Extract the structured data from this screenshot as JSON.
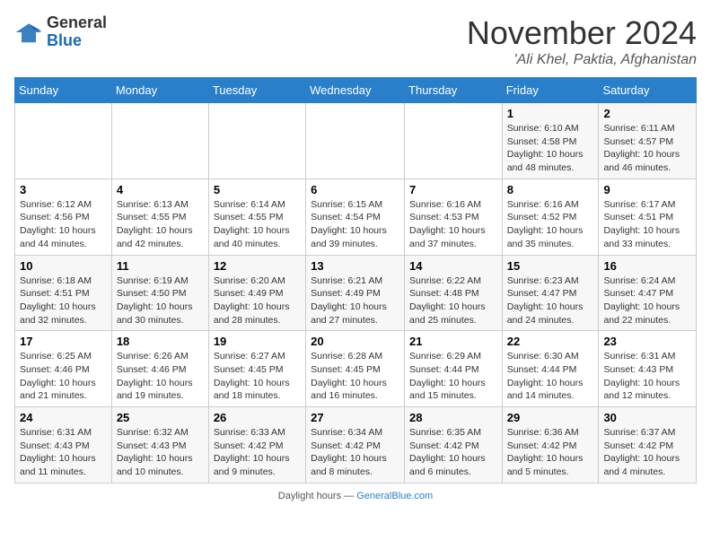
{
  "header": {
    "logo": {
      "general": "General",
      "blue": "Blue"
    },
    "title": "November 2024",
    "location": "'Ali Khel, Paktia, Afghanistan"
  },
  "days_of_week": [
    "Sunday",
    "Monday",
    "Tuesday",
    "Wednesday",
    "Thursday",
    "Friday",
    "Saturday"
  ],
  "weeks": [
    [
      {
        "day": "",
        "info": ""
      },
      {
        "day": "",
        "info": ""
      },
      {
        "day": "",
        "info": ""
      },
      {
        "day": "",
        "info": ""
      },
      {
        "day": "",
        "info": ""
      },
      {
        "day": "1",
        "info": "Sunrise: 6:10 AM\nSunset: 4:58 PM\nDaylight: 10 hours and 48 minutes."
      },
      {
        "day": "2",
        "info": "Sunrise: 6:11 AM\nSunset: 4:57 PM\nDaylight: 10 hours and 46 minutes."
      }
    ],
    [
      {
        "day": "3",
        "info": "Sunrise: 6:12 AM\nSunset: 4:56 PM\nDaylight: 10 hours and 44 minutes."
      },
      {
        "day": "4",
        "info": "Sunrise: 6:13 AM\nSunset: 4:55 PM\nDaylight: 10 hours and 42 minutes."
      },
      {
        "day": "5",
        "info": "Sunrise: 6:14 AM\nSunset: 4:55 PM\nDaylight: 10 hours and 40 minutes."
      },
      {
        "day": "6",
        "info": "Sunrise: 6:15 AM\nSunset: 4:54 PM\nDaylight: 10 hours and 39 minutes."
      },
      {
        "day": "7",
        "info": "Sunrise: 6:16 AM\nSunset: 4:53 PM\nDaylight: 10 hours and 37 minutes."
      },
      {
        "day": "8",
        "info": "Sunrise: 6:16 AM\nSunset: 4:52 PM\nDaylight: 10 hours and 35 minutes."
      },
      {
        "day": "9",
        "info": "Sunrise: 6:17 AM\nSunset: 4:51 PM\nDaylight: 10 hours and 33 minutes."
      }
    ],
    [
      {
        "day": "10",
        "info": "Sunrise: 6:18 AM\nSunset: 4:51 PM\nDaylight: 10 hours and 32 minutes."
      },
      {
        "day": "11",
        "info": "Sunrise: 6:19 AM\nSunset: 4:50 PM\nDaylight: 10 hours and 30 minutes."
      },
      {
        "day": "12",
        "info": "Sunrise: 6:20 AM\nSunset: 4:49 PM\nDaylight: 10 hours and 28 minutes."
      },
      {
        "day": "13",
        "info": "Sunrise: 6:21 AM\nSunset: 4:49 PM\nDaylight: 10 hours and 27 minutes."
      },
      {
        "day": "14",
        "info": "Sunrise: 6:22 AM\nSunset: 4:48 PM\nDaylight: 10 hours and 25 minutes."
      },
      {
        "day": "15",
        "info": "Sunrise: 6:23 AM\nSunset: 4:47 PM\nDaylight: 10 hours and 24 minutes."
      },
      {
        "day": "16",
        "info": "Sunrise: 6:24 AM\nSunset: 4:47 PM\nDaylight: 10 hours and 22 minutes."
      }
    ],
    [
      {
        "day": "17",
        "info": "Sunrise: 6:25 AM\nSunset: 4:46 PM\nDaylight: 10 hours and 21 minutes."
      },
      {
        "day": "18",
        "info": "Sunrise: 6:26 AM\nSunset: 4:46 PM\nDaylight: 10 hours and 19 minutes."
      },
      {
        "day": "19",
        "info": "Sunrise: 6:27 AM\nSunset: 4:45 PM\nDaylight: 10 hours and 18 minutes."
      },
      {
        "day": "20",
        "info": "Sunrise: 6:28 AM\nSunset: 4:45 PM\nDaylight: 10 hours and 16 minutes."
      },
      {
        "day": "21",
        "info": "Sunrise: 6:29 AM\nSunset: 4:44 PM\nDaylight: 10 hours and 15 minutes."
      },
      {
        "day": "22",
        "info": "Sunrise: 6:30 AM\nSunset: 4:44 PM\nDaylight: 10 hours and 14 minutes."
      },
      {
        "day": "23",
        "info": "Sunrise: 6:31 AM\nSunset: 4:43 PM\nDaylight: 10 hours and 12 minutes."
      }
    ],
    [
      {
        "day": "24",
        "info": "Sunrise: 6:31 AM\nSunset: 4:43 PM\nDaylight: 10 hours and 11 minutes."
      },
      {
        "day": "25",
        "info": "Sunrise: 6:32 AM\nSunset: 4:43 PM\nDaylight: 10 hours and 10 minutes."
      },
      {
        "day": "26",
        "info": "Sunrise: 6:33 AM\nSunset: 4:42 PM\nDaylight: 10 hours and 9 minutes."
      },
      {
        "day": "27",
        "info": "Sunrise: 6:34 AM\nSunset: 4:42 PM\nDaylight: 10 hours and 8 minutes."
      },
      {
        "day": "28",
        "info": "Sunrise: 6:35 AM\nSunset: 4:42 PM\nDaylight: 10 hours and 6 minutes."
      },
      {
        "day": "29",
        "info": "Sunrise: 6:36 AM\nSunset: 4:42 PM\nDaylight: 10 hours and 5 minutes."
      },
      {
        "day": "30",
        "info": "Sunrise: 6:37 AM\nSunset: 4:42 PM\nDaylight: 10 hours and 4 minutes."
      }
    ]
  ],
  "footer": {
    "text": "Daylight hours",
    "source": "GeneralBlue.com"
  }
}
